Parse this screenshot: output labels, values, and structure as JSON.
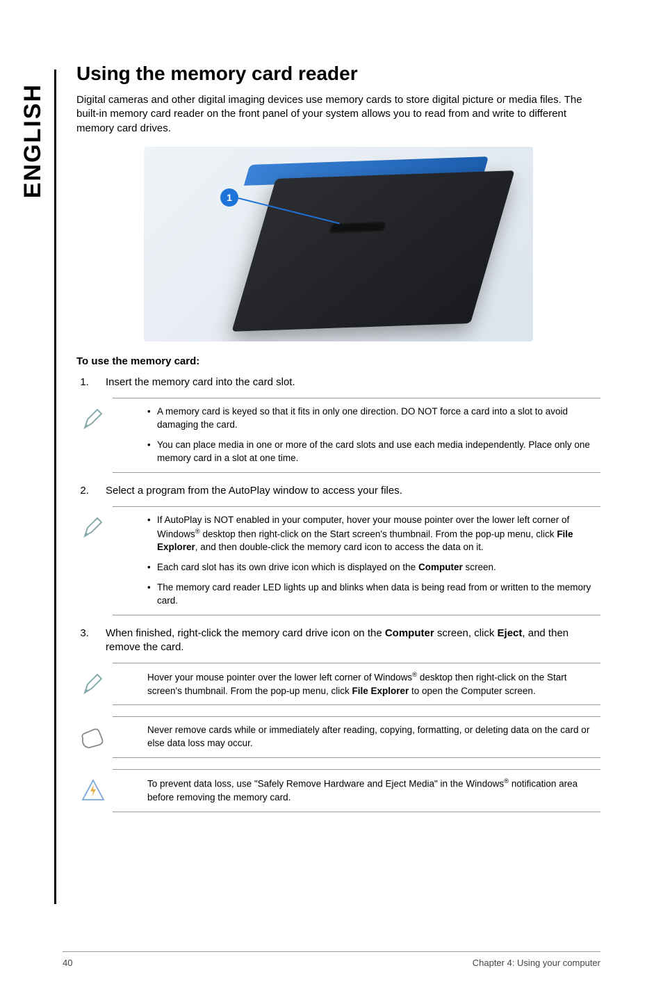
{
  "side_tab": "ENGLISH",
  "title": "Using the memory card reader",
  "intro": "Digital cameras and other digital imaging devices use memory cards to store digital picture or media files. The built-in memory card reader on the front panel of your system allows you to read from and write to different memory card drives.",
  "callout_number": "1",
  "sub_head": "To use the memory card:",
  "steps": {
    "s1": "Insert the memory card into the card slot.",
    "s2": "Select a program from the AutoPlay window to access your files.",
    "s3_prefix": "When finished, right-click the memory card drive icon on the ",
    "s3_bold1": "Computer",
    "s3_mid": " screen, click ",
    "s3_bold2": "Eject",
    "s3_suffix": ", and then remove the card."
  },
  "note1": {
    "b1": "A memory card is keyed so that it fits in only one direction. DO NOT force a card into a slot to avoid damaging the card.",
    "b2": "You can place media in one or more of the card slots and use each media independently. Place only one memory card in a slot at one time."
  },
  "note2": {
    "b1_a": "If AutoPlay is NOT enabled in your computer, hover your mouse pointer over the lower left corner of Windows",
    "b1_b": " desktop then right-click on the Start screen's thumbnail. From the pop-up menu, click ",
    "b1_bold": "File Explorer",
    "b1_c": ", and then double-click the memory card icon to access the data on it.",
    "b2_a": "Each card slot has its own drive icon which is displayed on the ",
    "b2_bold": "Computer",
    "b2_b": " screen.",
    "b3": "The memory card reader LED lights up and blinks when data is being read from or written to the memory card."
  },
  "note3": {
    "a": "Hover your mouse pointer over the lower left corner of Windows",
    "b": " desktop then right-click on the Start screen's thumbnail. From the pop-up menu, click ",
    "bold": "File Explorer",
    "c": " to open the Computer screen."
  },
  "note4": "Never remove cards while or immediately after reading, copying, formatting, or deleting data on the card or else data loss may occur.",
  "note5": {
    "a": "To prevent data loss, use \"Safely Remove Hardware and Eject Media\" in the Windows",
    "b": " notification area before removing the memory card."
  },
  "footer": {
    "page": "40",
    "chapter": "Chapter 4: Using your computer"
  },
  "reg": "®"
}
